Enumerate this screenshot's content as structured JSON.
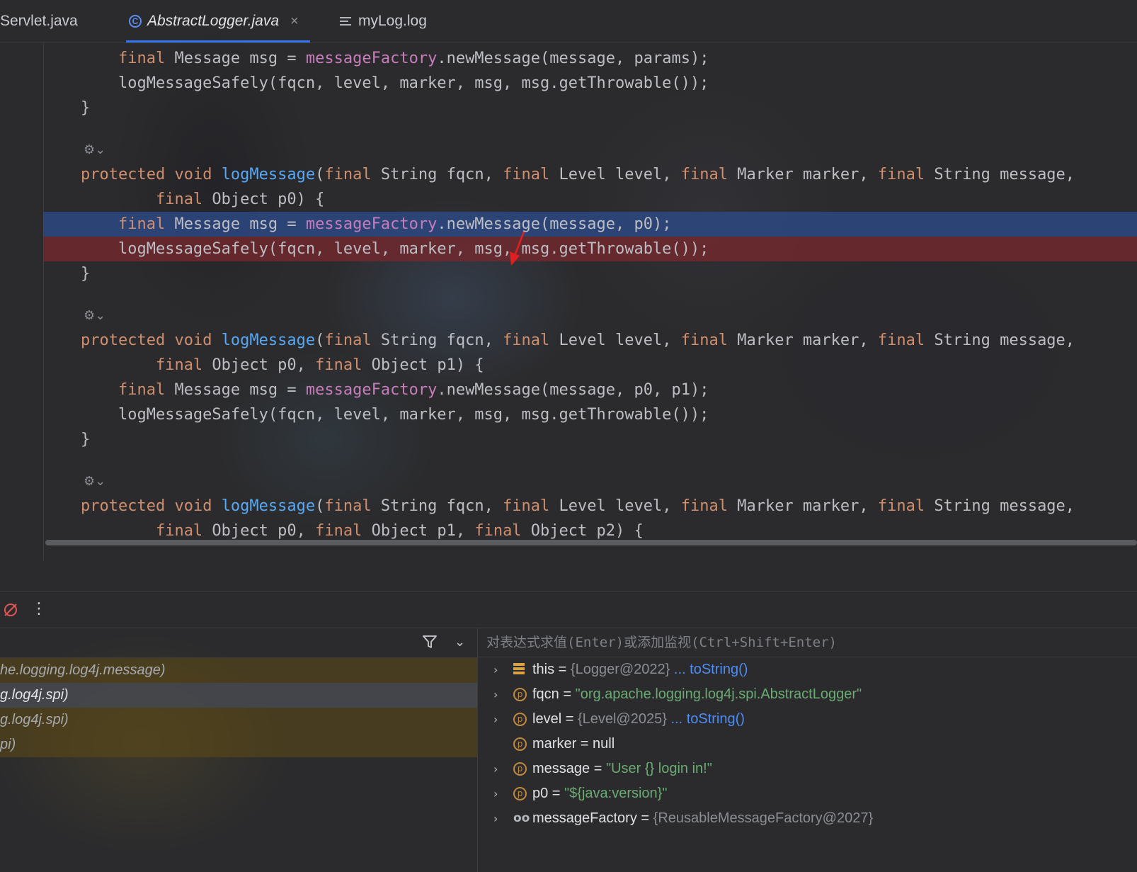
{
  "tabs": [
    {
      "label": "Servlet.java",
      "active": false
    },
    {
      "label": "AbstractLogger.java",
      "active": true,
      "close": "×"
    },
    {
      "label": "myLog.log",
      "active": false
    }
  ],
  "code": {
    "l1_indent": "        ",
    "kw_final": "final",
    "kw_protected": "protected",
    "kw_void": "void",
    "fn_logMessage": "logMessage",
    "fld_messageFactory": "messageFactory",
    "lines": {
      "a1_tail": " Message msg = ",
      "a1_call_params": ".newMessage(message, params);",
      "a2": "    logMessageSafely(fqcn, level, marker, msg, msg.getThrowable());",
      "close": "}",
      "sig_open": "(",
      "sig_p1": " String fqcn, ",
      "sig_p2": " Level level, ",
      "sig_p3": " Marker marker, ",
      "sig_p4": " String message,",
      "cont_p0": " Object p0) {",
      "cont_p0p1_a": " Object p0, ",
      "cont_p0p1_b": " Object p1) {",
      "cont_p0p1p2_a": " Object p0, ",
      "cont_p0p1p2_b": " Object p1, ",
      "cont_p0p1p2_c": " Object p2) {",
      "call_p0": ".newMessage(message, p0);",
      "call_p0p1": ".newMessage(message, p0, p1);"
    },
    "gutter_mark": "⚙⌄"
  },
  "debugger": {
    "eval_placeholder": "对表达式求值(Enter)或添加监视(Ctrl+Shift+Enter)",
    "frames": [
      "he.logging.log4j.message)",
      "g.log4j.spi)",
      "g.log4j.spi)",
      "pi)"
    ],
    "variables": [
      {
        "icon": "this",
        "expandable": true,
        "name": "this",
        "value": "{Logger@2022}",
        "link": "... toString()"
      },
      {
        "icon": "p",
        "expandable": true,
        "name": "fqcn",
        "string": "\"org.apache.logging.log4j.spi.AbstractLogger\""
      },
      {
        "icon": "p",
        "expandable": true,
        "name": "level",
        "value": "{Level@2025}",
        "link": "... toString()"
      },
      {
        "icon": "p",
        "expandable": false,
        "name": "marker",
        "plain": "null"
      },
      {
        "icon": "p",
        "expandable": true,
        "name": "message",
        "string": "\"User {} login in!\""
      },
      {
        "icon": "p",
        "expandable": true,
        "name": "p0",
        "string": "\"${java:version}\""
      },
      {
        "icon": "oo",
        "expandable": true,
        "name": "messageFactory",
        "value": "{ReusableMessageFactory@2027}"
      }
    ],
    "equals": " = ",
    "expand_glyph": "›",
    "p_glyph": "p",
    "oo_glyph": "oo"
  },
  "colors": {
    "keyword": "#cf8e6d",
    "function": "#56a8f5",
    "field": "#c77dbb",
    "string": "#6aab73",
    "exec_line": "#2d4882",
    "breakpoint_line": "#782d2d",
    "accent": "#3574f0"
  }
}
